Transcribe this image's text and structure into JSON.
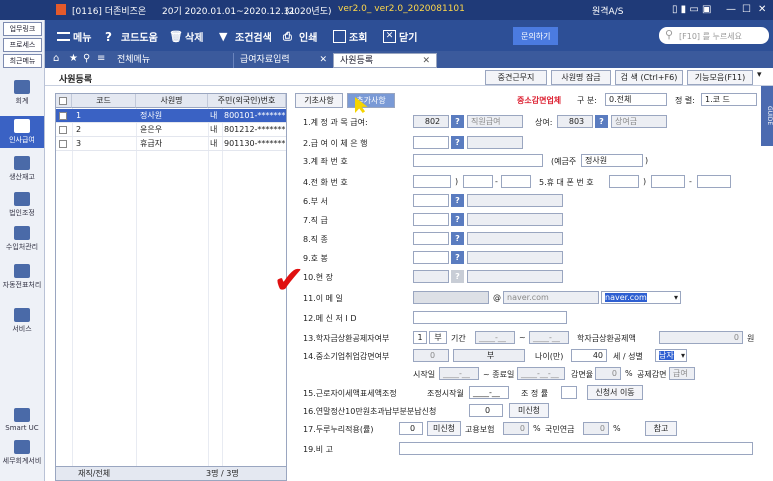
{
  "titlebar": {
    "code": "[0116] 더존비즈온",
    "period": "20기 2020.01.01~2020.12.31",
    "year": "(2020년도)",
    "version": "ver2.0_ ver2.0_2020081101",
    "remote": "원격A/S"
  },
  "toolbar": {
    "menu": "메뉴",
    "codehelp": "코드도움",
    "delete": "삭제",
    "search": "조건검색",
    "print": "인쇄",
    "lookup": "조회",
    "close": "닫기",
    "inquiry": "문의하기",
    "search_placeholder": "[F10] 를 누르세요"
  },
  "sidebar": {
    "buttons": [
      "업무링크",
      "프로세스",
      "최근메뉴"
    ],
    "nav": [
      "회계",
      "인사급여",
      "생산재고",
      "법인조정",
      "수입처관리",
      "자동전표처리",
      "서비스",
      "Smart UC",
      "세무회계서비"
    ]
  },
  "tabs": {
    "all": "전체메뉴",
    "payroll": "급여자료입력",
    "employee": "사원등록"
  },
  "subbar": {
    "title": "사원등록",
    "b1": "중견근무지",
    "b2": "사원명 잠금",
    "b3": "검 색 (Ctrl+F6)",
    "b4": "기능모음(F11)"
  },
  "grid": {
    "headers": [
      "코드",
      "사원명",
      "주민(외국인)번호"
    ],
    "rows": [
      {
        "code": "1",
        "name": "정사원",
        "type": "내",
        "rrn": "800101-*******"
      },
      {
        "code": "2",
        "name": "윤은우",
        "type": "내",
        "rrn": "801212-*******"
      },
      {
        "code": "3",
        "name": "휴급자",
        "type": "내",
        "rrn": "901130-*******"
      }
    ],
    "footer_label": "재직/전체",
    "footer_value": "3명 / 3명"
  },
  "form": {
    "tab_basic": "기초사항",
    "tab_other": "추가사항",
    "taxreduce": "중소감면업체",
    "gubun_label": "구 분:",
    "gubun_value": "0.전체",
    "sort_label": "정 렬:",
    "sort_value": "1.코 드",
    "r1": "1.계 정 과 목 급여:",
    "r1_code": "802",
    "r1_name": "직원급여",
    "r1_bonus": "상여:",
    "r1_code2": "803",
    "r1_name2": "상여금",
    "r2": "2.급 여 이 체 은 행",
    "r3": "3.계 좌 번 호",
    "r3_holder_label": "(예금주",
    "r3_holder": "정사원",
    "r3_close": ")",
    "r4": "4.전 화 번 호",
    "r5": "5.휴 대 폰 번 호",
    "r6": "6.부 서",
    "r7": "7.직 급",
    "r8": "8.직 종",
    "r9": "9.호 봉",
    "r10": "10.현 장",
    "r11": "11.이 메 일",
    "r11_at": "@",
    "r11_domain": "naver.com",
    "r11_sel": "naver.com",
    "r12": "12.메 신 저 I D",
    "r13": "13.학자금상환공제자여부",
    "r13_val": "1",
    "r13_yn": "부",
    "r13_period": "기간",
    "r13_from": "____-__",
    "r13_to": "____-__",
    "r13_amt_label": "학자금상환공제액",
    "r13_amt": "0",
    "r13_won": "원",
    "r14": "14.중소기업취업감면여부",
    "r14_val": "0",
    "r14_yn": "부",
    "r14_age_label": "나이(만)",
    "r14_age": "40",
    "r14_gender_label": "세 / 성별",
    "r14_gender": "남자",
    "r14_start": "시작일",
    "r14_start_v": "____-__",
    "r14_end": "~ 종료일",
    "r14_end_v": "____-__-__",
    "r14_rate": "감면율",
    "r14_rate_v": "0",
    "r14_pct": "%",
    "r14_rate2": "공제감면",
    "r14_rate2_v": "급여",
    "r15": "15.근로자이세액표세액조정",
    "r15_start": "조정시작월",
    "r15_start_v": "____-__",
    "r15_adj": "조 정 률",
    "r15_btn": "신청서 이동",
    "r16": "16.연말정산10만원초과납부분분납신청",
    "r16_val": "0",
    "r16_btn": "미신청",
    "r17": "17.두루누리적용(률)",
    "r17_val": "0",
    "r17_btn": "미신청",
    "r17_emp": "고용보험",
    "r17_emp_v": "0",
    "r17_pct1": "%",
    "r17_np": "국민연금",
    "r17_np_v": "0",
    "r17_pct2": "%",
    "r17_ref": "참고",
    "r19": "19.비 고"
  },
  "guide": "GUIDE"
}
